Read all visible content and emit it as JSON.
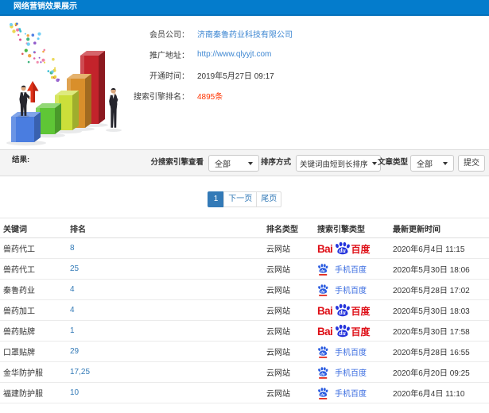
{
  "title_bar": {
    "title": "网络营销效果展示"
  },
  "member_info": {
    "rows": [
      {
        "label": "会员公司：",
        "value": "济南秦鲁药业科技有限公司",
        "style": "link"
      },
      {
        "label": "推广地址：",
        "value": "http://www.qlyyjt.com",
        "style": "link"
      },
      {
        "label": "开通时间：",
        "value": "2019年5月27日 09:17",
        "style": "text"
      },
      {
        "label": "搜索引擎排名：",
        "value": "4895条",
        "style": "highlight"
      }
    ]
  },
  "filter_bar": {
    "section_label": "结果:",
    "engine_filter_label": "分搜索引擎查看",
    "engine_filter_value": "全部",
    "sort_label": "排序方式",
    "sort_value": "关键词由短到长排序",
    "article_type_label": "文章类型",
    "article_type_value": "全部",
    "submit_label": "提交"
  },
  "pagination": {
    "current_page": "1",
    "next_label": "下一页",
    "last_label": "尾页"
  },
  "ranking_table": {
    "columns": [
      "关键词",
      "排名",
      "排名类型",
      "搜索引擎类型",
      "最新更新时间"
    ],
    "rows": [
      {
        "keyword": "兽药代工",
        "rank": "8",
        "rank_type": "云网站",
        "engine": "baidu-pc",
        "engine_name": "百度",
        "updated": "2020年6月4日 11:15"
      },
      {
        "keyword": "兽药代工",
        "rank": "25",
        "rank_type": "云网站",
        "engine": "baidu-mobile",
        "engine_name": "手机百度",
        "updated": "2020年5月30日 18:06"
      },
      {
        "keyword": "秦鲁药业",
        "rank": "4",
        "rank_type": "云网站",
        "engine": "baidu-mobile",
        "engine_name": "手机百度",
        "updated": "2020年5月28日 17:02"
      },
      {
        "keyword": "兽药加工",
        "rank": "4",
        "rank_type": "云网站",
        "engine": "baidu-pc",
        "engine_name": "百度",
        "updated": "2020年5月30日 18:03"
      },
      {
        "keyword": "兽药贴牌",
        "rank": "1",
        "rank_type": "云网站",
        "engine": "baidu-pc",
        "engine_name": "百度",
        "updated": "2020年5月30日 17:58"
      },
      {
        "keyword": "口罩贴牌",
        "rank": "29",
        "rank_type": "云网站",
        "engine": "baidu-mobile",
        "engine_name": "手机百度",
        "updated": "2020年5月28日 16:55"
      },
      {
        "keyword": "金华防护服",
        "rank": "17,25",
        "rank_type": "云网站",
        "engine": "baidu-mobile",
        "engine_name": "手机百度",
        "updated": "2020年6月20日 09:25"
      },
      {
        "keyword": "福建防护服",
        "rank": "10",
        "rank_type": "云网站",
        "engine": "baidu-mobile",
        "engine_name": "手机百度",
        "updated": "2020年6月4日 11:10"
      }
    ]
  },
  "logos": {
    "baidu_pc": {
      "bai": "Bai",
      "du": "du",
      "baidu": "百度"
    },
    "baidu_mobile": {
      "du": "du",
      "label": "手机百度"
    }
  },
  "colors": {
    "titlebar_bg": "#047ccc",
    "link_blue": "#3e87d2",
    "highlight_red": "#ff3300",
    "pagination_active": "#337ab7",
    "table_rank_blue": "#337ab7",
    "baidu_red": "#de0f17",
    "baidu_blue": "#2534dc",
    "baidu_mobile_blue": "#2b5ce0"
  },
  "illustration": {
    "bar_colors": [
      "#4a7de0",
      "#5fc636",
      "#ccdf3a",
      "#d98f2b",
      "#c3232b"
    ],
    "arrow_color": "#e03318",
    "figure_color": "#26262e"
  }
}
